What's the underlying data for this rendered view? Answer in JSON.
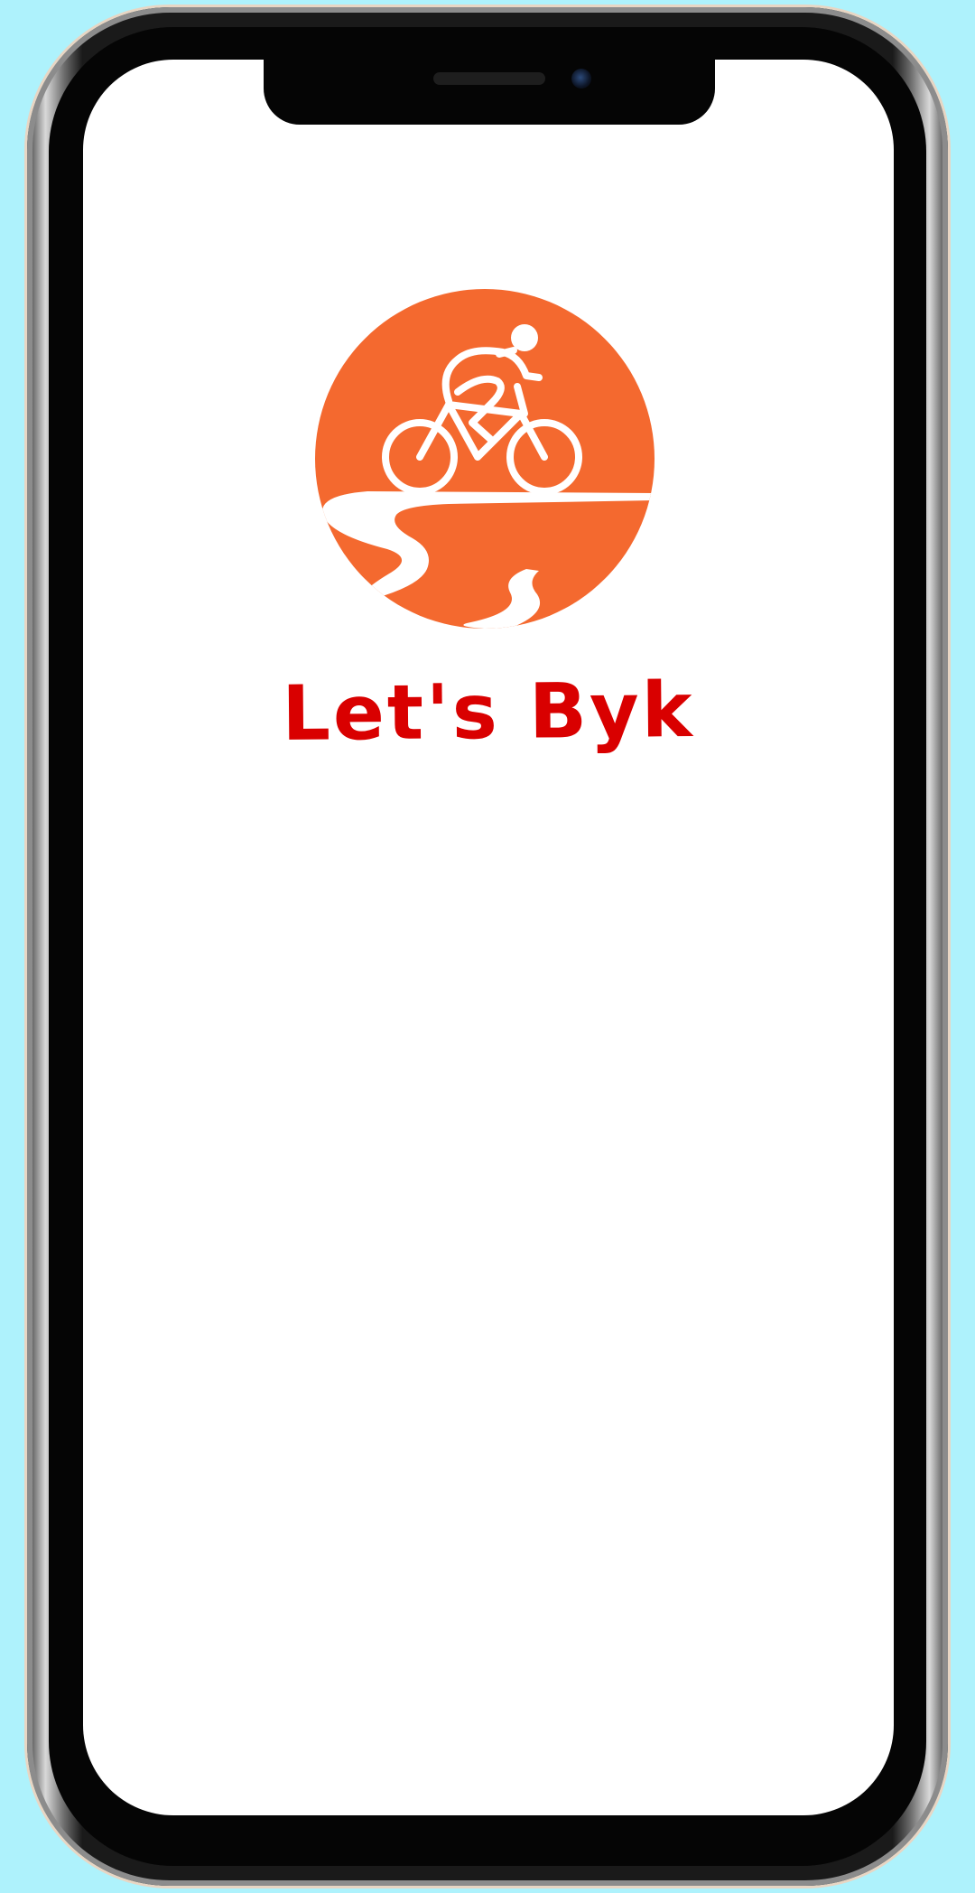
{
  "app": {
    "title": "Let's Byk"
  },
  "logo": {
    "icon": "cyclist-on-road-icon",
    "circle_color": "#f4692f",
    "figure_color": "#ffffff"
  },
  "colors": {
    "background": "#aef2fc",
    "screen": "#ffffff",
    "title_color": "#d90000"
  }
}
